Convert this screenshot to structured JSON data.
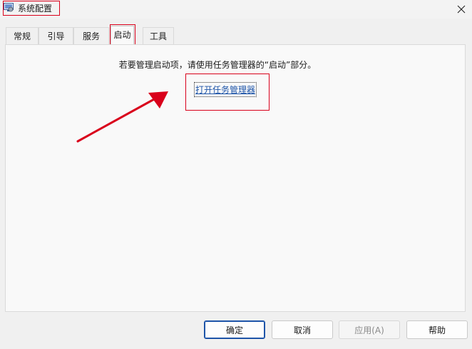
{
  "window": {
    "title": "系统配置"
  },
  "tabs": [
    {
      "label": "常规"
    },
    {
      "label": "引导"
    },
    {
      "label": "服务"
    },
    {
      "label": "启动"
    },
    {
      "label": "工具"
    }
  ],
  "active_tab": "启动",
  "startup_tab": {
    "instruction": "若要管理启动项，请使用任务管理器的“启动”部分。",
    "link_text": "打开任务管理器"
  },
  "buttons": {
    "ok": "确定",
    "cancel": "取消",
    "apply": "应用(A)",
    "help": "帮助"
  },
  "colors": {
    "annotation_red": "#d9001b",
    "link_blue": "#1d54a8"
  },
  "icons": {
    "app": "system-config-icon",
    "close": "close-icon"
  }
}
